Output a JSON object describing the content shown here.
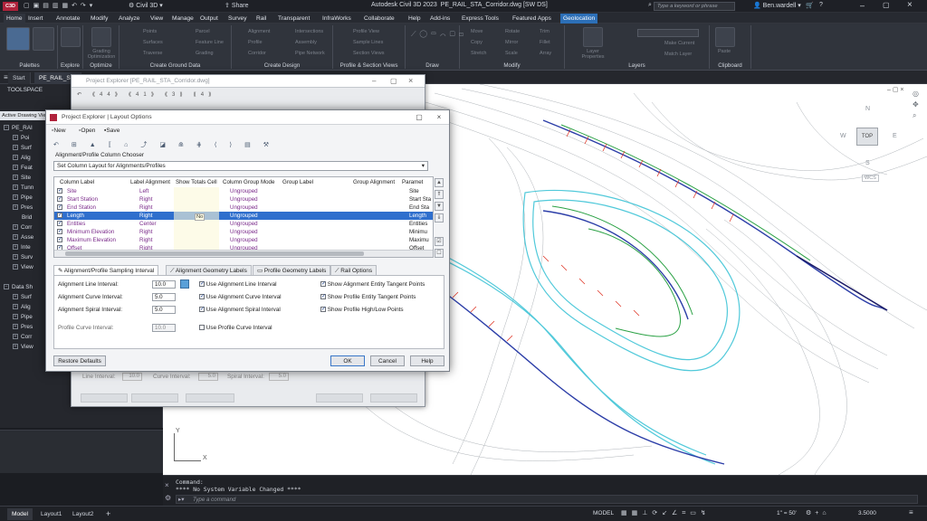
{
  "titlebar": {
    "app_icon": "C3D",
    "workspace": "Civil 3D",
    "share": "Share",
    "title": "Autodesk Civil 3D 2023",
    "document": "PE_RAIL_STA_Corridor.dwg [SW DS]",
    "search_placeholder": "Type a keyword or phrase",
    "user": "Ben.wardell"
  },
  "menu_tabs": [
    "Home",
    "Insert",
    "Annotate",
    "Modify",
    "Analyze",
    "View",
    "Manage",
    "Output",
    "Survey",
    "Rail",
    "Transparent",
    "InfraWorks",
    "Collaborate",
    "Help",
    "Add-ins",
    "Express Tools",
    "Featured Apps",
    "Geolocation"
  ],
  "ribbon": {
    "groups": [
      {
        "title": "Palettes",
        "buttons": []
      },
      {
        "title": "Explore",
        "buttons": []
      },
      {
        "title": "Optimize",
        "buttons": [
          "Grading Optimization"
        ]
      },
      {
        "title": "Create Ground Data",
        "buttons": [
          "Points",
          "Surfaces",
          "Traverse",
          "Parcel",
          "Feature Line",
          "Grading"
        ]
      },
      {
        "title": "Create Design",
        "buttons": [
          "Alignment",
          "Profile",
          "Corridor",
          "Intersections",
          "Assembly",
          "Pipe Network"
        ]
      },
      {
        "title": "Profile & Section Views",
        "buttons": [
          "Profile View",
          "Sample Lines",
          "Section Views"
        ]
      },
      {
        "title": "Draw",
        "buttons": []
      },
      {
        "title": "Modify",
        "buttons": [
          "Move",
          "Copy",
          "Stretch",
          "Rotate",
          "Mirror",
          "Scale",
          "Trim",
          "Fillet",
          "Array"
        ]
      },
      {
        "title": "Layers",
        "buttons": [
          "Layer Properties",
          "Make Current",
          "Match Layer"
        ]
      },
      {
        "title": "Clipboard",
        "buttons": [
          "Paste"
        ]
      }
    ]
  },
  "doctabs": [
    "Start",
    "PE_RAIL_STA..."
  ],
  "toolspace": {
    "title": "TOOLSPACE",
    "active_label": "Active Drawing Vie",
    "items": [
      "PE_RAI",
      "Poi",
      "Surf",
      "Alig",
      "Feat",
      "Site",
      "Tunn",
      "Pipe",
      "Pres",
      "Brid",
      "Corr",
      "Asse",
      "Inte",
      "Surv",
      "View",
      "Data Sh",
      "Surf",
      "Alig",
      "Pipe",
      "Pres",
      "Corr",
      "View"
    ]
  },
  "dialog_back": {
    "title": "Project Explorer [PE_RAIL_STA_Corridor.dwg]",
    "line_interval_label": "Line Interval:",
    "line_interval": "10.0",
    "curve_interval_label": "Curve Interval:",
    "curve_interval": "5.0",
    "spiral_interval_label": "Spiral Interval:",
    "spiral_interval": "5.0"
  },
  "dialog": {
    "title": "Project Explorer | Layout Options",
    "toolbar": {
      "new": "New",
      "open": "Open",
      "save": "Save"
    },
    "chooser_label": "Alignment/Profile Column Chooser",
    "layout_select": "Set Column Layout for Alignments/Profiles",
    "columns": [
      "Column Label",
      "Label Alignment",
      "Show Totals Cell",
      "Column Group Mode",
      "Group Label",
      "Group Alignment",
      "Paramet"
    ],
    "rows": [
      {
        "label": "Site",
        "align": "Left",
        "group_mode": "Ungrouped",
        "param": "Site",
        "selected": false
      },
      {
        "label": "Start Station",
        "align": "Right",
        "group_mode": "Ungrouped",
        "param": "Start Sta",
        "selected": false
      },
      {
        "label": "End Station",
        "align": "Right",
        "group_mode": "Ungrouped",
        "param": "End Sta",
        "selected": false
      },
      {
        "label": "Length",
        "align": "Right",
        "group_mode": "Ungrouped",
        "param": "Length",
        "selected": true
      },
      {
        "label": "Entities",
        "align": "Center",
        "group_mode": "Ungrouped",
        "param": "Entities",
        "selected": false
      },
      {
        "label": "Minimum Elevation",
        "align": "Right",
        "group_mode": "Ungrouped",
        "param": "Minimu",
        "selected": false
      },
      {
        "label": "Maximum Elevation",
        "align": "Right",
        "group_mode": "Ungrouped",
        "param": "Maximu",
        "selected": false
      },
      {
        "label": "Offset",
        "align": "Right",
        "group_mode": "Ungrouped",
        "param": "Offset",
        "selected": false
      }
    ],
    "tooltip": "No",
    "tabs": [
      "Alignment/Profile Sampling Interval",
      "Alignment Geometry Labels",
      "Profile Geometry Labels",
      "Rail Options"
    ],
    "alignment_line_interval_label": "Alignment Line Interval:",
    "alignment_line_interval": "10.0",
    "alignment_curve_interval_label": "Alignment Curve Interval:",
    "alignment_curve_interval": "5.0",
    "alignment_spiral_interval_label": "Alignment Spiral Interval:",
    "alignment_spiral_interval": "5.0",
    "profile_curve_interval_label": "Profile Curve Interval:",
    "profile_curve_interval": "10.0",
    "checks": {
      "use_line": "Use Alignment Line Interval",
      "use_curve": "Use Alignment Curve Interval",
      "use_spiral": "Use Alignment Spiral Interval",
      "use_profile_curve": "Use Profile Curve Interval",
      "show_entity_tangent": "Show Alignment Entity Tangent Points",
      "show_profile_tangent": "Show Profile Entity Tangent Points",
      "show_high_low": "Show Profile High/Low Points"
    },
    "buttons": {
      "restore": "Restore Defaults",
      "ok": "OK",
      "cancel": "Cancel",
      "help": "Help"
    }
  },
  "viewcube": {
    "top": "TOP",
    "north": "N",
    "south": "S",
    "east": "E",
    "west": "W",
    "wcs": "WCS"
  },
  "ucs": {
    "x": "X",
    "y": "Y"
  },
  "command": {
    "line1": "Command:",
    "line2": "**** No System Variable Changed ****",
    "placeholder": "Type a command"
  },
  "status": {
    "tabs": [
      "Model",
      "Layout1",
      "Layout2"
    ],
    "model": "MODEL",
    "scale": "1\" = 50'",
    "value": "3.5000"
  },
  "colors": {
    "accent": "#2c6fb7",
    "selection": "#2f6fcd",
    "ribbon": "#30343c"
  }
}
